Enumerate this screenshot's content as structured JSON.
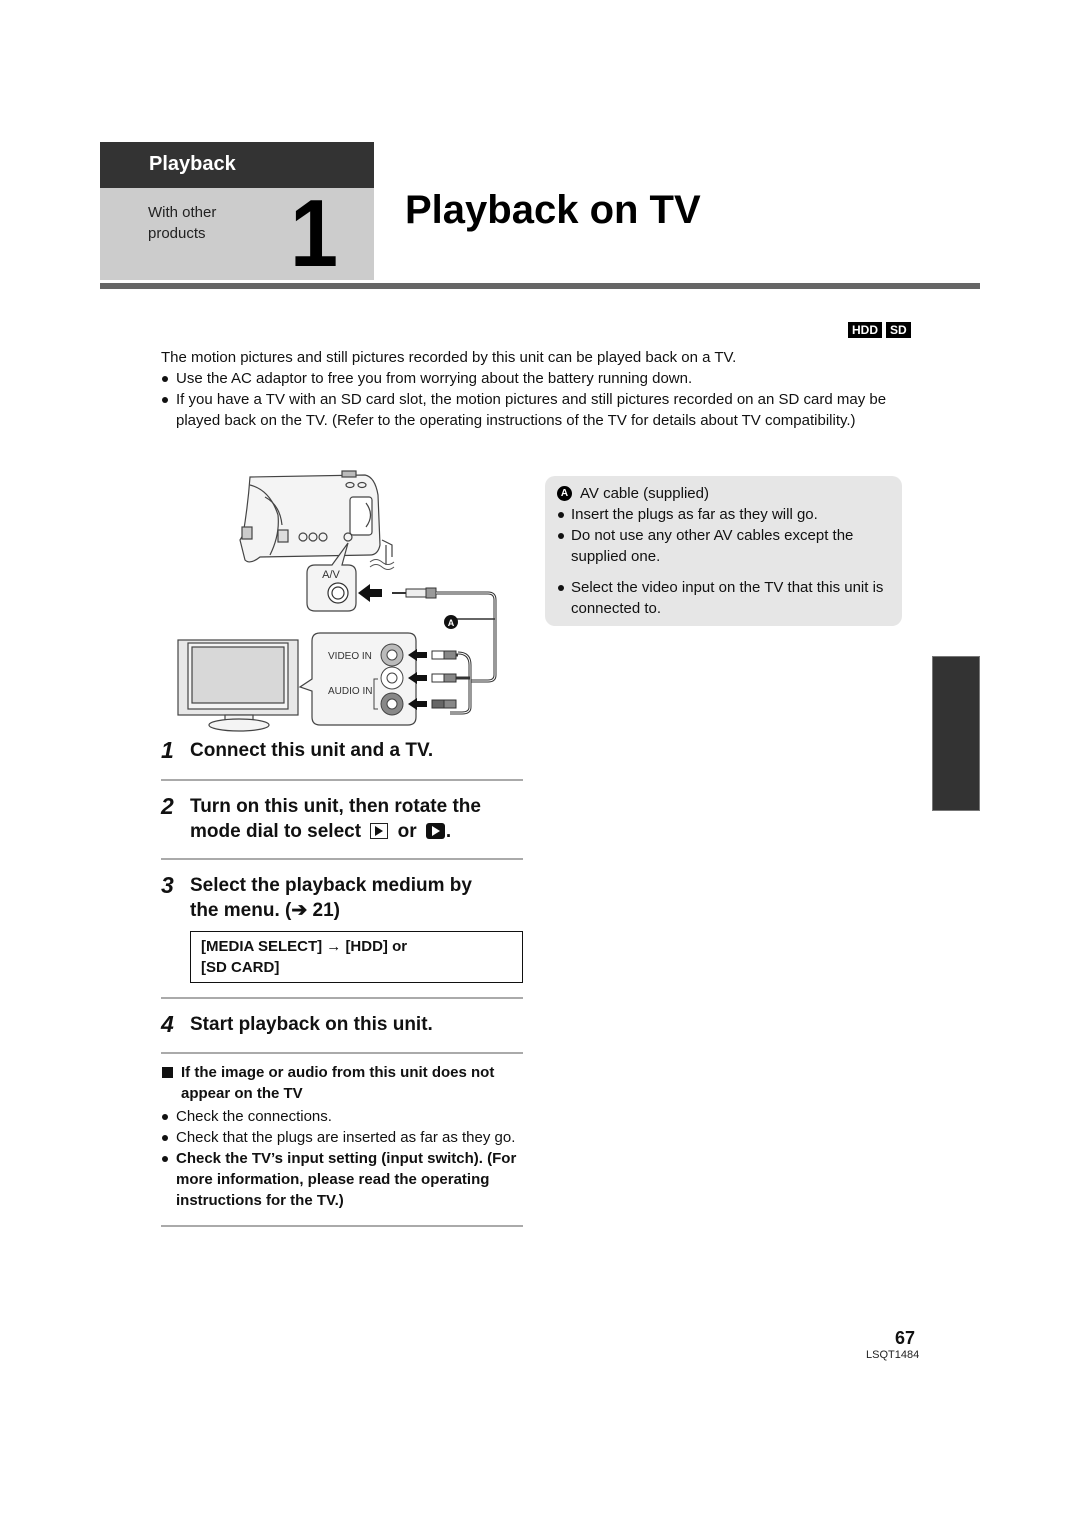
{
  "section_tab": {
    "header": "Playback",
    "subtitle_line1": "With other",
    "subtitle_line2": "products",
    "number": "1"
  },
  "page_title": "Playback on TV",
  "media_badges": [
    "HDD",
    "SD"
  ],
  "intro": {
    "text": "The motion pictures and still pictures recorded by this unit can be played back on a TV.",
    "bullets": [
      "Use the AC adaptor to free you from worrying about the battery running down.",
      "If you have a TV with an SD card slot, the motion pictures and still pictures recorded on an SD card may be played back on the TV. (Refer to the operating instructions of the TV for details about TV compatibility.)"
    ]
  },
  "diagram": {
    "av_label": "A/V",
    "video_in_label": "VIDEO IN",
    "audio_in_label": "AUDIO IN",
    "callout_letter": "A",
    "icons": [
      "camcorder-icon",
      "tv-icon",
      "av-cable-icon",
      "arrow-icon"
    ]
  },
  "note": {
    "marker": "A",
    "caption": "AV cable (supplied)",
    "bullets": [
      "Insert the plugs as far as they will go.",
      "Do not use any other AV cables except the supplied one.",
      "Select the video input on the TV that this unit is connected to."
    ]
  },
  "steps": [
    {
      "num": "1",
      "text": "Connect this unit and a TV."
    },
    {
      "num": "2",
      "text_line1": "Turn on this unit, then rotate the",
      "text_before": "mode dial to select",
      "text_or": "or",
      "text_end": ".",
      "icons": [
        "play-mode-icon",
        "picture-playback-icon"
      ]
    },
    {
      "num": "3",
      "text_line1": "Select the playback medium by",
      "text_line2": "the menu. (➔ 21)"
    },
    {
      "num": "4",
      "text": "Start playback on this unit."
    }
  ],
  "menu_path": {
    "line1": "[MEDIA SELECT] → [HDD] or",
    "line2": "[SD CARD]"
  },
  "trouble": {
    "heading": "If the image or audio from this unit does not appear on the TV",
    "bullets": [
      "Check the connections.",
      "Check that the plugs are inserted as far as they go."
    ],
    "bold_bullet": "Check the TV’s input setting (input switch). (For more information, please read the operating instructions for the TV.)"
  },
  "footer": {
    "page_number": "67",
    "doc_code": "LSQT1484"
  }
}
